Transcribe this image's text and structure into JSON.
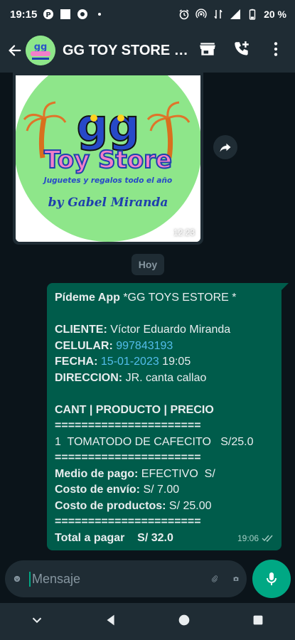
{
  "status_bar": {
    "time": "19:15",
    "battery": "20 %"
  },
  "header": {
    "title": "GG TOY STORE B..."
  },
  "image_message": {
    "time": "12:23",
    "logo_text": {
      "gg": "gg",
      "brand": "Toy Store",
      "tagline": "Juguetes y regalos todo el año",
      "signature": "by Gabel Miranda"
    }
  },
  "date_chip": "Hoy",
  "message": {
    "lines": [
      {
        "bold": "Pídeme App ",
        "text": "*GG TOYS ESTORE *"
      },
      {
        "bold": "",
        "text": ""
      },
      {
        "bold": "CLIENTE: ",
        "text": "Víctor Eduardo Miranda"
      },
      {
        "bold": "CELULAR: ",
        "link": "997843193"
      },
      {
        "bold": "FECHA: ",
        "link": "15-01-2023",
        "text": " 19:05"
      },
      {
        "bold": "DIRECCION: ",
        "text": "JR. canta callao"
      },
      {
        "bold": "",
        "text": ""
      },
      {
        "bold": "CANT | PRODUCTO | PRECIO",
        "text": ""
      },
      {
        "bold": "======================",
        "text": ""
      },
      {
        "bold": "",
        "text": "1  TOMATODO DE CAFECITO   S/25.0"
      },
      {
        "bold": "======================",
        "text": ""
      },
      {
        "bold": "Medio de pago: ",
        "text": "EFECTIVO  S/"
      },
      {
        "bold": "Costo de envío: ",
        "text": "S/ 7.00"
      },
      {
        "bold": "Costo de productos: ",
        "text": "S/ 25.00"
      },
      {
        "bold": "======================",
        "text": ""
      },
      {
        "bold": "Total a pagar    S/ 32.0",
        "text": ""
      }
    ],
    "time": "19:06"
  },
  "input": {
    "placeholder": "Mensaje"
  },
  "colors": {
    "header_bg": "#1f2c34",
    "chat_bg": "#0b141a",
    "outgoing_bubble": "#005c4b",
    "accent": "#00a884",
    "link": "#53bdeb"
  }
}
